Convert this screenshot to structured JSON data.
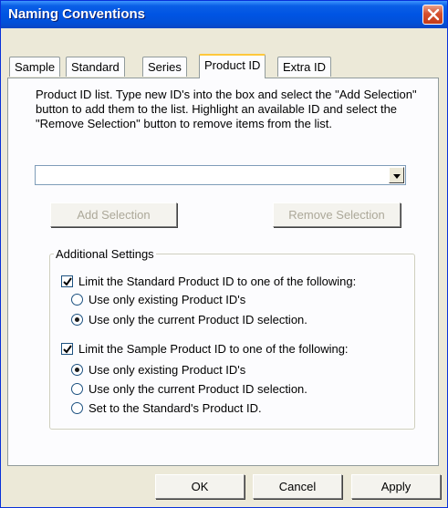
{
  "window": {
    "title": "Naming Conventions"
  },
  "tabs": [
    {
      "label": "Sample",
      "active": false
    },
    {
      "label": "Standard",
      "active": false
    },
    {
      "label": "Series",
      "active": false
    },
    {
      "label": "Product ID",
      "active": true
    },
    {
      "label": "Extra ID",
      "active": false
    }
  ],
  "product_id": {
    "description": "Product ID list. Type new ID's into the box and select the \"Add Selection\" button to add them to the list. Highlight an available ID and select the \"Remove Selection\" button to remove items from the list.",
    "combo_value": "",
    "add_label": "Add Selection",
    "remove_label": "Remove Selection"
  },
  "additional": {
    "group_label": "Additional Settings",
    "standard_limit": {
      "label": "Limit the Standard Product ID to one of the following:",
      "checked": true,
      "options": [
        {
          "label": "Use only existing Product ID's",
          "selected": false
        },
        {
          "label": "Use only the current Product ID selection.",
          "selected": true
        }
      ]
    },
    "sample_limit": {
      "label": "Limit the Sample Product ID to one of the following:",
      "checked": true,
      "options": [
        {
          "label": "Use only existing Product ID's",
          "selected": true
        },
        {
          "label": "Use only the current Product ID selection.",
          "selected": false
        },
        {
          "label": "Set to the Standard's Product ID.",
          "selected": false
        }
      ]
    }
  },
  "footer": {
    "ok_label": "OK",
    "cancel_label": "Cancel",
    "apply_label": "Apply"
  },
  "icons": {
    "close": "close-icon",
    "dropdown": "chevron-down-icon",
    "check": "check-icon"
  },
  "colors": {
    "titlebar": "#0054e3",
    "dialog_bg": "#ece9d8",
    "active_tab_accent": "#ffc83c",
    "close_button": "#d4502e"
  }
}
